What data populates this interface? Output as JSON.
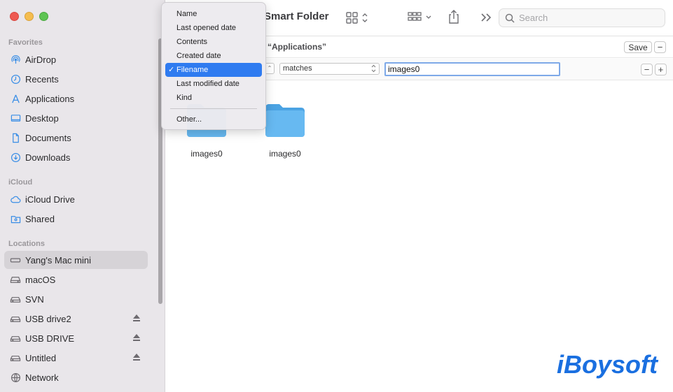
{
  "window": {
    "title": "Smart Folder"
  },
  "sidebar": {
    "sections": [
      {
        "label": "Favorites",
        "items": [
          {
            "label": "AirDrop",
            "icon": "airdrop-icon"
          },
          {
            "label": "Recents",
            "icon": "clock-icon"
          },
          {
            "label": "Applications",
            "icon": "applications-icon"
          },
          {
            "label": "Desktop",
            "icon": "desktop-icon"
          },
          {
            "label": "Documents",
            "icon": "document-icon"
          },
          {
            "label": "Downloads",
            "icon": "download-icon"
          }
        ]
      },
      {
        "label": "iCloud",
        "items": [
          {
            "label": "iCloud Drive",
            "icon": "cloud-icon"
          },
          {
            "label": "Shared",
            "icon": "shared-folder-icon"
          }
        ]
      },
      {
        "label": "Locations",
        "items": [
          {
            "label": "Yang's Mac mini",
            "icon": "computer-icon",
            "selected": true
          },
          {
            "label": "macOS",
            "icon": "drive-icon"
          },
          {
            "label": "SVN",
            "icon": "external-drive-icon"
          },
          {
            "label": "USB drive2",
            "icon": "external-drive-icon",
            "eject": true
          },
          {
            "label": "USB DRIVE",
            "icon": "external-drive-icon",
            "eject": true
          },
          {
            "label": "Untitled",
            "icon": "external-drive-icon",
            "eject": true
          },
          {
            "label": "Network",
            "icon": "network-icon"
          }
        ]
      }
    ]
  },
  "toolbar": {
    "search_placeholder": "Search"
  },
  "scope": {
    "text": "“Applications”",
    "save_label": "Save",
    "minus": "−"
  },
  "criteria": {
    "operator": "matches",
    "value": "images0",
    "minus": "−",
    "plus": "+"
  },
  "files": [
    {
      "name": "images0"
    },
    {
      "name": "images0"
    }
  ],
  "menu": {
    "items": [
      {
        "label": "Name",
        "checked": false
      },
      {
        "label": "Last opened date",
        "checked": false
      },
      {
        "label": "Contents",
        "checked": false
      },
      {
        "label": "Created date",
        "checked": false
      },
      {
        "label": "Filename",
        "checked": true
      },
      {
        "label": "Last modified date",
        "checked": false
      },
      {
        "label": "Kind",
        "checked": false
      }
    ],
    "other": "Other...",
    "check": "✓"
  },
  "watermark": {
    "logo_text": "iBoysoft"
  },
  "colors": {
    "accent": "#2f7bf0",
    "folder": "#5ab2ee",
    "sidebar_bg": "#e9e6ea"
  }
}
